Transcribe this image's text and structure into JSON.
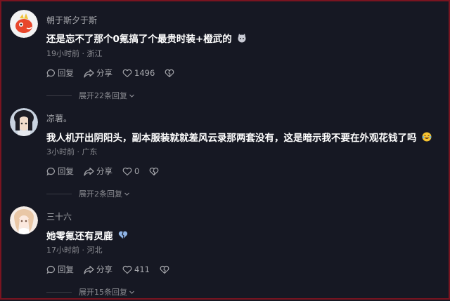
{
  "comments": [
    {
      "username": "朝于斯夕于斯",
      "text": "还是忘不了那个0氪搞了个最贵时装+橙武的",
      "time_location": "19小时前 · 浙江",
      "reply_label": "回复",
      "share_label": "分享",
      "likes": "1496",
      "expand_label": "展开22条回复"
    },
    {
      "username": "凉薯。",
      "text": "我人机开出阴阳头，副本服装就就差风云录那两套没有，这是暗示我不要在外观花钱了吗",
      "time_location": "3小时前 · 广东",
      "reply_label": "回复",
      "share_label": "分享",
      "likes": "0",
      "expand_label": "展开2条回复"
    },
    {
      "username": "三十六",
      "text": "她零氪还有灵鹿",
      "time_location": "17小时前 · 河北",
      "reply_label": "回复",
      "share_label": "分享",
      "likes": "411",
      "expand_label": "展开15条回复"
    }
  ],
  "colors": {
    "background": "#161823",
    "border": "#7a1420",
    "text_primary": "#ffffff",
    "text_secondary": "#a7a8ad"
  }
}
